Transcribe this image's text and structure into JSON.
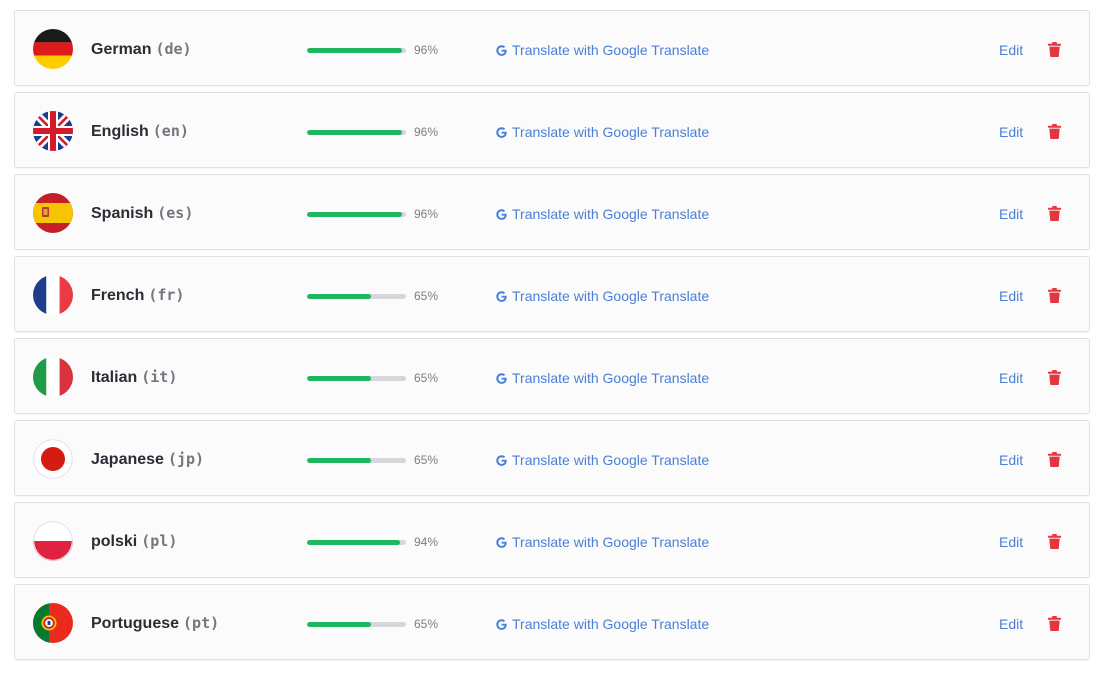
{
  "colors": {
    "progress_fill": "#1db760",
    "progress_track": "#d5d7da",
    "link": "#4a7fd6",
    "delete": "#e3363f",
    "row_border": "#dde1e7"
  },
  "languages": [
    {
      "name": "German",
      "code": "(de)",
      "progress_label": "96%",
      "progress": 96,
      "flag_icon": "germany-flag-icon",
      "translate_label": "Translate with Google Translate",
      "edit_label": "Edit",
      "delete_icon": "trash-icon"
    },
    {
      "name": "English",
      "code": "(en)",
      "progress_label": "96%",
      "progress": 96,
      "flag_icon": "uk-flag-icon",
      "translate_label": "Translate with Google Translate",
      "edit_label": "Edit",
      "delete_icon": "trash-icon"
    },
    {
      "name": "Spanish",
      "code": "(es)",
      "progress_label": "96%",
      "progress": 96,
      "flag_icon": "spain-flag-icon",
      "translate_label": "Translate with Google Translate",
      "edit_label": "Edit",
      "delete_icon": "trash-icon"
    },
    {
      "name": "French",
      "code": "(fr)",
      "progress_label": "65%",
      "progress": 65,
      "flag_icon": "france-flag-icon",
      "translate_label": "Translate with Google Translate",
      "edit_label": "Edit",
      "delete_icon": "trash-icon"
    },
    {
      "name": "Italian",
      "code": "(it)",
      "progress_label": "65%",
      "progress": 65,
      "flag_icon": "italy-flag-icon",
      "translate_label": "Translate with Google Translate",
      "edit_label": "Edit",
      "delete_icon": "trash-icon"
    },
    {
      "name": "Japanese",
      "code": "(jp)",
      "progress_label": "65%",
      "progress": 65,
      "flag_icon": "japan-flag-icon",
      "translate_label": "Translate with Google Translate",
      "edit_label": "Edit",
      "delete_icon": "trash-icon"
    },
    {
      "name": "polski",
      "code": "(pl)",
      "progress_label": "94%",
      "progress": 94,
      "flag_icon": "poland-flag-icon",
      "translate_label": "Translate with Google Translate",
      "edit_label": "Edit",
      "delete_icon": "trash-icon"
    },
    {
      "name": "Portuguese",
      "code": "(pt)",
      "progress_label": "65%",
      "progress": 65,
      "flag_icon": "portugal-flag-icon",
      "translate_label": "Translate with Google Translate",
      "edit_label": "Edit",
      "delete_icon": "trash-icon"
    }
  ]
}
